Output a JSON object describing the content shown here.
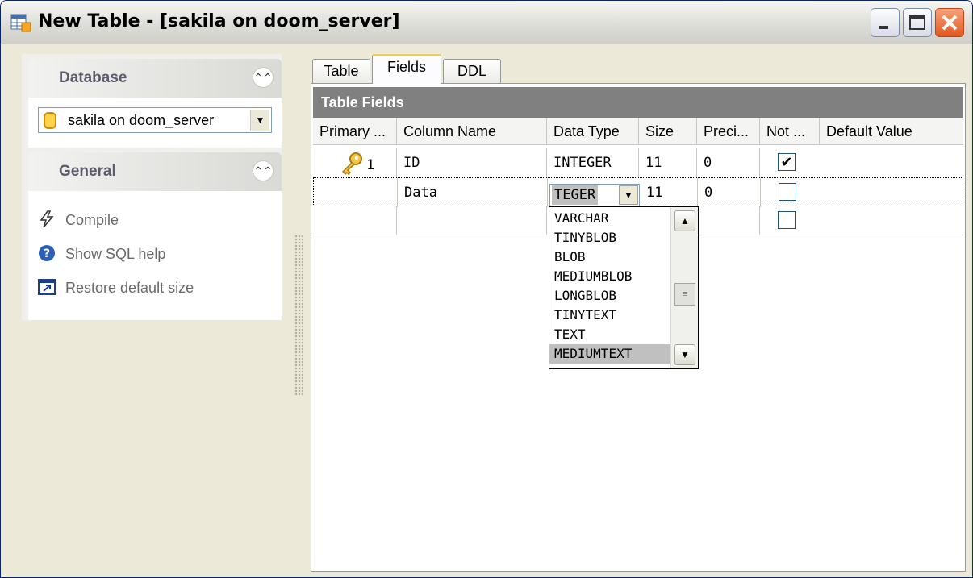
{
  "window": {
    "title": "New Table - [sakila on doom_server]",
    "minimize_icon": "minimize-icon",
    "maximize_icon": "maximize-icon",
    "close_icon": "close-icon"
  },
  "sidebar": {
    "database": {
      "header": "Database",
      "selected_db": "sakila on doom_server"
    },
    "general": {
      "header": "General",
      "items": [
        {
          "label": "Compile",
          "icon": "lightning-icon"
        },
        {
          "label": "Show SQL help",
          "icon": "help-icon"
        },
        {
          "label": "Restore default size",
          "icon": "restore-window-icon"
        }
      ]
    }
  },
  "tabs": [
    {
      "label": "Table"
    },
    {
      "label": "Fields",
      "active": true
    },
    {
      "label": "DDL"
    }
  ],
  "grid": {
    "title": "Table Fields",
    "columns": [
      "Primary ...",
      "Column Name",
      "Data Type",
      "Size",
      "Preci...",
      "Not ...",
      "Default Value"
    ],
    "rows": [
      {
        "primary": "1",
        "name": "ID",
        "type": "INTEGER",
        "size": "11",
        "precision": "0",
        "not_null": true,
        "default": ""
      },
      {
        "primary": "",
        "name": "Data",
        "type": "TEGER",
        "size": "11",
        "precision": "0",
        "not_null": false,
        "default": ""
      },
      {
        "primary": "",
        "name": "",
        "type": "",
        "size": "",
        "precision": "",
        "not_null": false,
        "default": ""
      }
    ],
    "type_options": [
      "VARCHAR",
      "TINYBLOB",
      "BLOB",
      "MEDIUMBLOB",
      "LONGBLOB",
      "TINYTEXT",
      "TEXT",
      "MEDIUMTEXT"
    ],
    "selected_option": "MEDIUMTEXT"
  }
}
